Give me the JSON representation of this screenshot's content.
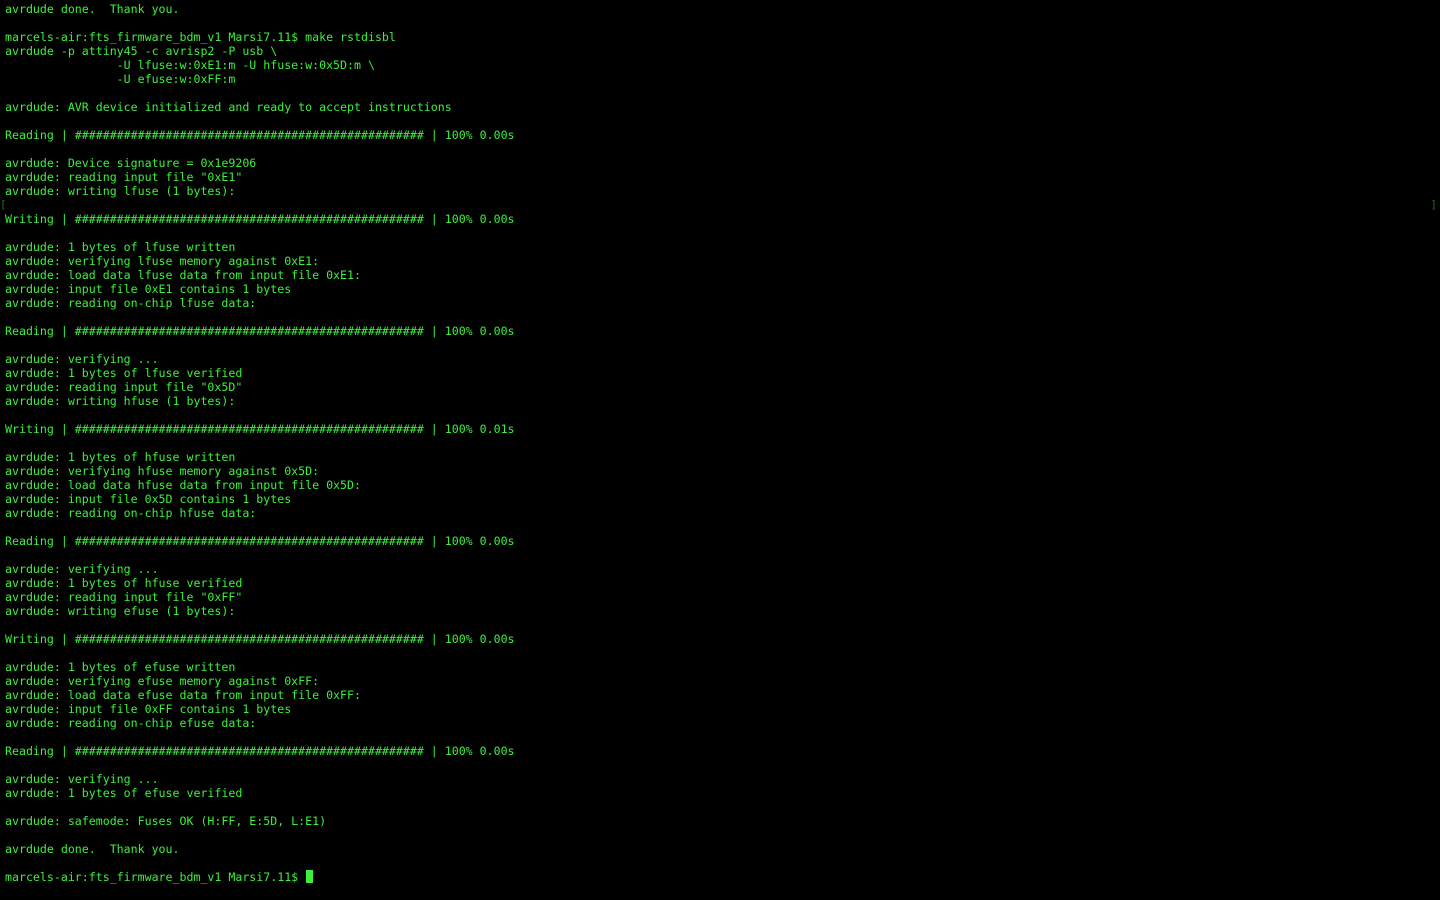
{
  "terminal": {
    "lines": [
      "avrdude done.  Thank you.",
      "",
      "marcels-air:fts_firmware_bdm_v1 Marsi7.11$ make rstdisbl",
      "avrdude -p attiny45 -c avrisp2 -P usb \\",
      "                -U lfuse:w:0xE1:m -U hfuse:w:0x5D:m \\",
      "                -U efuse:w:0xFF:m",
      "",
      "avrdude: AVR device initialized and ready to accept instructions",
      "",
      "Reading | ################################################## | 100% 0.00s",
      "",
      "avrdude: Device signature = 0x1e9206",
      "avrdude: reading input file \"0xE1\"",
      "avrdude: writing lfuse (1 bytes):",
      "",
      "Writing | ################################################## | 100% 0.00s",
      "",
      "avrdude: 1 bytes of lfuse written",
      "avrdude: verifying lfuse memory against 0xE1:",
      "avrdude: load data lfuse data from input file 0xE1:",
      "avrdude: input file 0xE1 contains 1 bytes",
      "avrdude: reading on-chip lfuse data:",
      "",
      "Reading | ################################################## | 100% 0.00s",
      "",
      "avrdude: verifying ...",
      "avrdude: 1 bytes of lfuse verified",
      "avrdude: reading input file \"0x5D\"",
      "avrdude: writing hfuse (1 bytes):",
      "",
      "Writing | ################################################## | 100% 0.01s",
      "",
      "avrdude: 1 bytes of hfuse written",
      "avrdude: verifying hfuse memory against 0x5D:",
      "avrdude: load data hfuse data from input file 0x5D:",
      "avrdude: input file 0x5D contains 1 bytes",
      "avrdude: reading on-chip hfuse data:",
      "",
      "Reading | ################################################## | 100% 0.00s",
      "",
      "avrdude: verifying ...",
      "avrdude: 1 bytes of hfuse verified",
      "avrdude: reading input file \"0xFF\"",
      "avrdude: writing efuse (1 bytes):",
      "",
      "Writing | ################################################## | 100% 0.00s",
      "",
      "avrdude: 1 bytes of efuse written",
      "avrdude: verifying efuse memory against 0xFF:",
      "avrdude: load data efuse data from input file 0xFF:",
      "avrdude: input file 0xFF contains 1 bytes",
      "avrdude: reading on-chip efuse data:",
      "",
      "Reading | ################################################## | 100% 0.00s",
      "",
      "avrdude: verifying ...",
      "avrdude: 1 bytes of efuse verified",
      "",
      "avrdude: safemode: Fuses OK (H:FF, E:5D, L:E1)",
      "",
      "avrdude done.  Thank you.",
      ""
    ],
    "prompt": "marcels-air:fts_firmware_bdm_v1 Marsi7.11$ ",
    "left_edge_glyph": "[",
    "right_edge_glyph": "]",
    "colors": {
      "background": "#000000",
      "text": "#3cf03c",
      "cursor": "#3cf03c"
    }
  }
}
